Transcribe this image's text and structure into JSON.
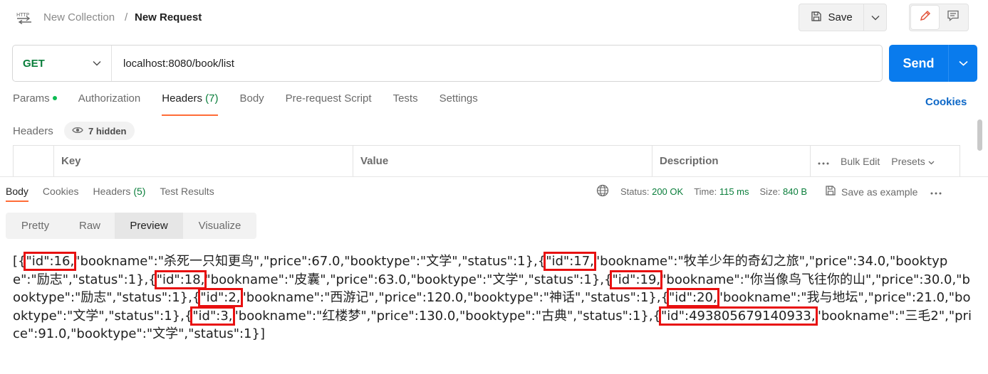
{
  "breadcrumb": {
    "collection": "New Collection",
    "separator": "/",
    "request": "New Request"
  },
  "toolbar": {
    "save_label": "Save"
  },
  "request": {
    "method": "GET",
    "url": "localhost:8080/book/list",
    "send_label": "Send"
  },
  "request_tabs": {
    "params": "Params",
    "authorization": "Authorization",
    "headers": "Headers",
    "headers_count": "(7)",
    "body": "Body",
    "pre_request": "Pre-request Script",
    "tests": "Tests",
    "settings": "Settings",
    "cookies": "Cookies"
  },
  "headers_section": {
    "title": "Headers",
    "hidden": "7 hidden",
    "columns": {
      "key": "Key",
      "value": "Value",
      "description": "Description"
    },
    "bulk_edit": "Bulk Edit",
    "presets": "Presets"
  },
  "response_tabs": {
    "body": "Body",
    "cookies": "Cookies",
    "headers": "Headers",
    "headers_count": "(5)",
    "test_results": "Test Results"
  },
  "response_meta": {
    "status_label": "Status:",
    "status_value": "200 OK",
    "time_label": "Time:",
    "time_value": "115 ms",
    "size_label": "Size:",
    "size_value": "840 B",
    "save_example": "Save as example"
  },
  "view_tabs": {
    "pretty": "Pretty",
    "raw": "Raw",
    "preview": "Preview",
    "visualize": "Visualize"
  },
  "preview": {
    "open": "[{",
    "id1": "\"id\":16,",
    "r1": "\"bookname\":\"杀死一只知更鸟\",\"price\":67.0,\"booktype\":\"文学\",\"status\":1},{",
    "id2": "\"id\":17,",
    "r2": "\"bookname\":\"牧羊少年的奇幻之旅\",\"price\":34.0,\"booktype\":\"励志\",\"status\":1},{",
    "id3": "\"id\":18,",
    "r3": "\"bookname\":\"皮囊\",\"price\":63.0,\"booktype\":\"文学\",\"status\":1},{",
    "id4": "\"id\":19,",
    "r4": "\"bookname\":\"你当像鸟飞往你的山\",\"price\":30.0,\"booktype\":\"励志\",\"status\":1},{",
    "id5": "\"id\":2,",
    "r5": "\"bookname\":\"西游记\",\"price\":120.0,\"booktype\":\"神话\",\"status\":1},{",
    "id6": "\"id\":20,",
    "r6": "\"bookname\":\"我与地坛\",\"price\":21.0,\"booktype\":\"文学\",\"status\":1},{",
    "id7": "\"id\":3,",
    "r7": "\"bookname\":\"红楼梦\",\"price\":130.0,\"booktype\":\"古典\",\"status\":1},{",
    "id8": "\"id\":493805679140933,",
    "r8": "\"bookname\":\"三毛2\",\"price\":91.0,\"booktype\":\"文学\",\"status\":1}]"
  },
  "colors": {
    "accent": "#ff6c37",
    "send_blue": "#097bed",
    "method_green": "#0a7e3b",
    "link_blue": "#0c67c7",
    "highlight_red": "#e81010"
  }
}
